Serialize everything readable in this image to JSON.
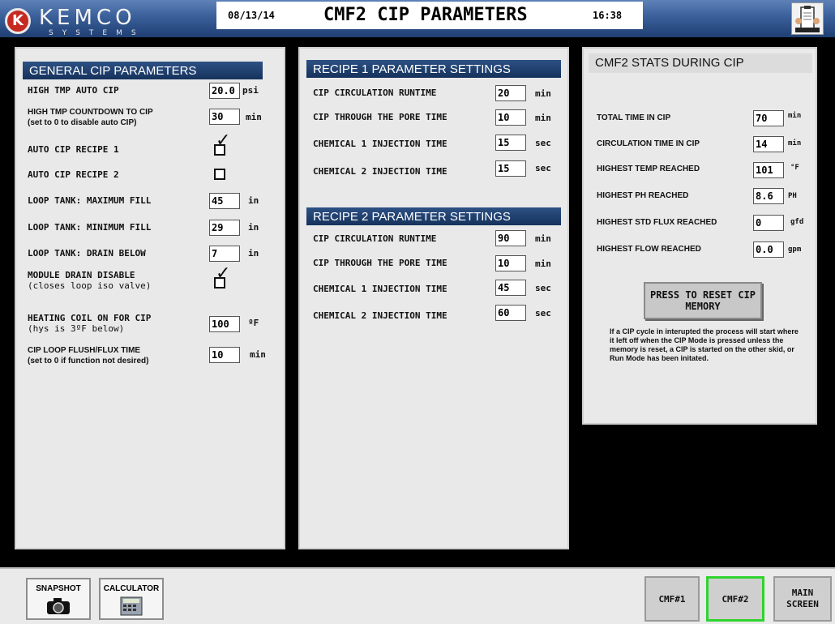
{
  "header": {
    "logo_main": "KEMCO",
    "logo_sub": "SYSTEMS",
    "logo_mark": "K",
    "date": "08/13/14",
    "title": "CMF2 CIP PARAMETERS",
    "time": "16:38"
  },
  "general": {
    "title": "GENERAL CIP PARAMETERS",
    "rows": [
      {
        "label": "HIGH TMP AUTO CIP",
        "value": "20.0",
        "unit": "psi"
      },
      {
        "label": "HIGH TMP COUNTDOWN TO CIP",
        "sublabel": "(set to 0 to disable auto CIP)",
        "value": "30",
        "unit": "min"
      },
      {
        "label": "AUTO CIP RECIPE 1",
        "checked": true
      },
      {
        "label": "AUTO CIP RECIPE 2",
        "checked": false
      },
      {
        "label": "LOOP TANK: MAXIMUM FILL",
        "value": "45",
        "unit": "in"
      },
      {
        "label": "LOOP TANK: MINIMUM FILL",
        "value": "29",
        "unit": "in"
      },
      {
        "label": "LOOP TANK: DRAIN BELOW",
        "value": "7",
        "unit": "in"
      },
      {
        "label": "MODULE DRAIN DISABLE",
        "sublabel": "(closes loop iso valve)",
        "checked": true
      },
      {
        "label": "HEATING COIL ON FOR CIP",
        "sublabel": "(hys is 3ºF below)",
        "value": "100",
        "unit": "ºF"
      },
      {
        "label": "CIP LOOP FLUSH/FLUX TIME",
        "sublabel": "(set to 0 if function not desired)",
        "value": "10",
        "unit": "min"
      }
    ]
  },
  "recipe1": {
    "title": "RECIPE 1 PARAMETER SETTINGS",
    "rows": [
      {
        "label": "CIP CIRCULATION RUNTIME",
        "value": "20",
        "unit": "min"
      },
      {
        "label": "CIP THROUGH THE PORE TIME",
        "value": "10",
        "unit": "min"
      },
      {
        "label": "CHEMICAL 1 INJECTION TIME",
        "value": "15",
        "unit": "sec"
      },
      {
        "label": "CHEMICAL 2 INJECTION TIME",
        "value": "15",
        "unit": "sec"
      }
    ]
  },
  "recipe2": {
    "title": "RECIPE 2 PARAMETER SETTINGS",
    "rows": [
      {
        "label": "CIP CIRCULATION RUNTIME",
        "value": "90",
        "unit": "min"
      },
      {
        "label": "CIP THROUGH THE PORE TIME",
        "value": "10",
        "unit": "min"
      },
      {
        "label": "CHEMICAL 1 INJECTION TIME",
        "value": "45",
        "unit": "sec"
      },
      {
        "label": "CHEMICAL 2 INJECTION TIME",
        "value": "60",
        "unit": "sec"
      }
    ]
  },
  "stats": {
    "title": "CMF2 STATS DURING CIP",
    "rows": [
      {
        "label": "TOTAL TIME IN CIP",
        "value": "70",
        "unit": "min"
      },
      {
        "label": "CIRCULATION TIME IN CIP",
        "value": "14",
        "unit": "min"
      },
      {
        "label": "HIGHEST TEMP REACHED",
        "value": "101",
        "unit": "°F"
      },
      {
        "label": "HIGHEST PH REACHED",
        "value": "8.6",
        "unit": "PH"
      },
      {
        "label": "HIGHEST STD FLUX REACHED",
        "value": "0",
        "unit": "gfd"
      },
      {
        "label": "HIGHEST FLOW REACHED",
        "value": "0.0",
        "unit": "gpm"
      }
    ],
    "reset_button": "PRESS TO RESET CIP MEMORY",
    "note": "If a CIP cycle in interupted the process will start where it left off when the CIP Mode is pressed unless the memory is reset, a CIP is started on the other skid, or Run Mode has been initated."
  },
  "footer": {
    "snapshot": "SNAPSHOT",
    "calculator": "CALCULATOR",
    "cmf1": "CMF#1",
    "cmf2": "CMF#2",
    "main_screen": "MAIN SCREEN"
  },
  "colors": {
    "header_blue": "#3a5f99",
    "panel_title_blue": "#1f3f6e",
    "active_nav_border": "#2fd32f",
    "logo_red": "#c52a21"
  }
}
